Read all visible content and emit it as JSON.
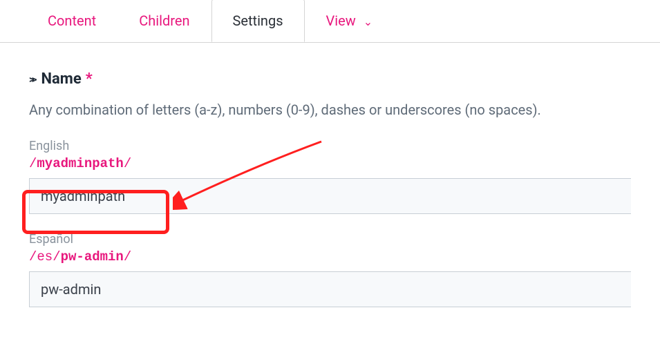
{
  "tabs": {
    "content": "Content",
    "children": "Children",
    "settings": "Settings",
    "view": "View"
  },
  "field": {
    "title": "Name",
    "required_mark": "*",
    "description": "Any combination of letters (a-z), numbers (0-9), dashes or underscores (no spaces)."
  },
  "languages": [
    {
      "label": "English",
      "path_prefix": "/",
      "path_bold": "myadminpath",
      "path_suffix": "/",
      "value": "myadminpath"
    },
    {
      "label": "Español",
      "path_prefix": "/es/",
      "path_bold": "pw-admin",
      "path_suffix": "/",
      "value": "pw-admin"
    }
  ]
}
